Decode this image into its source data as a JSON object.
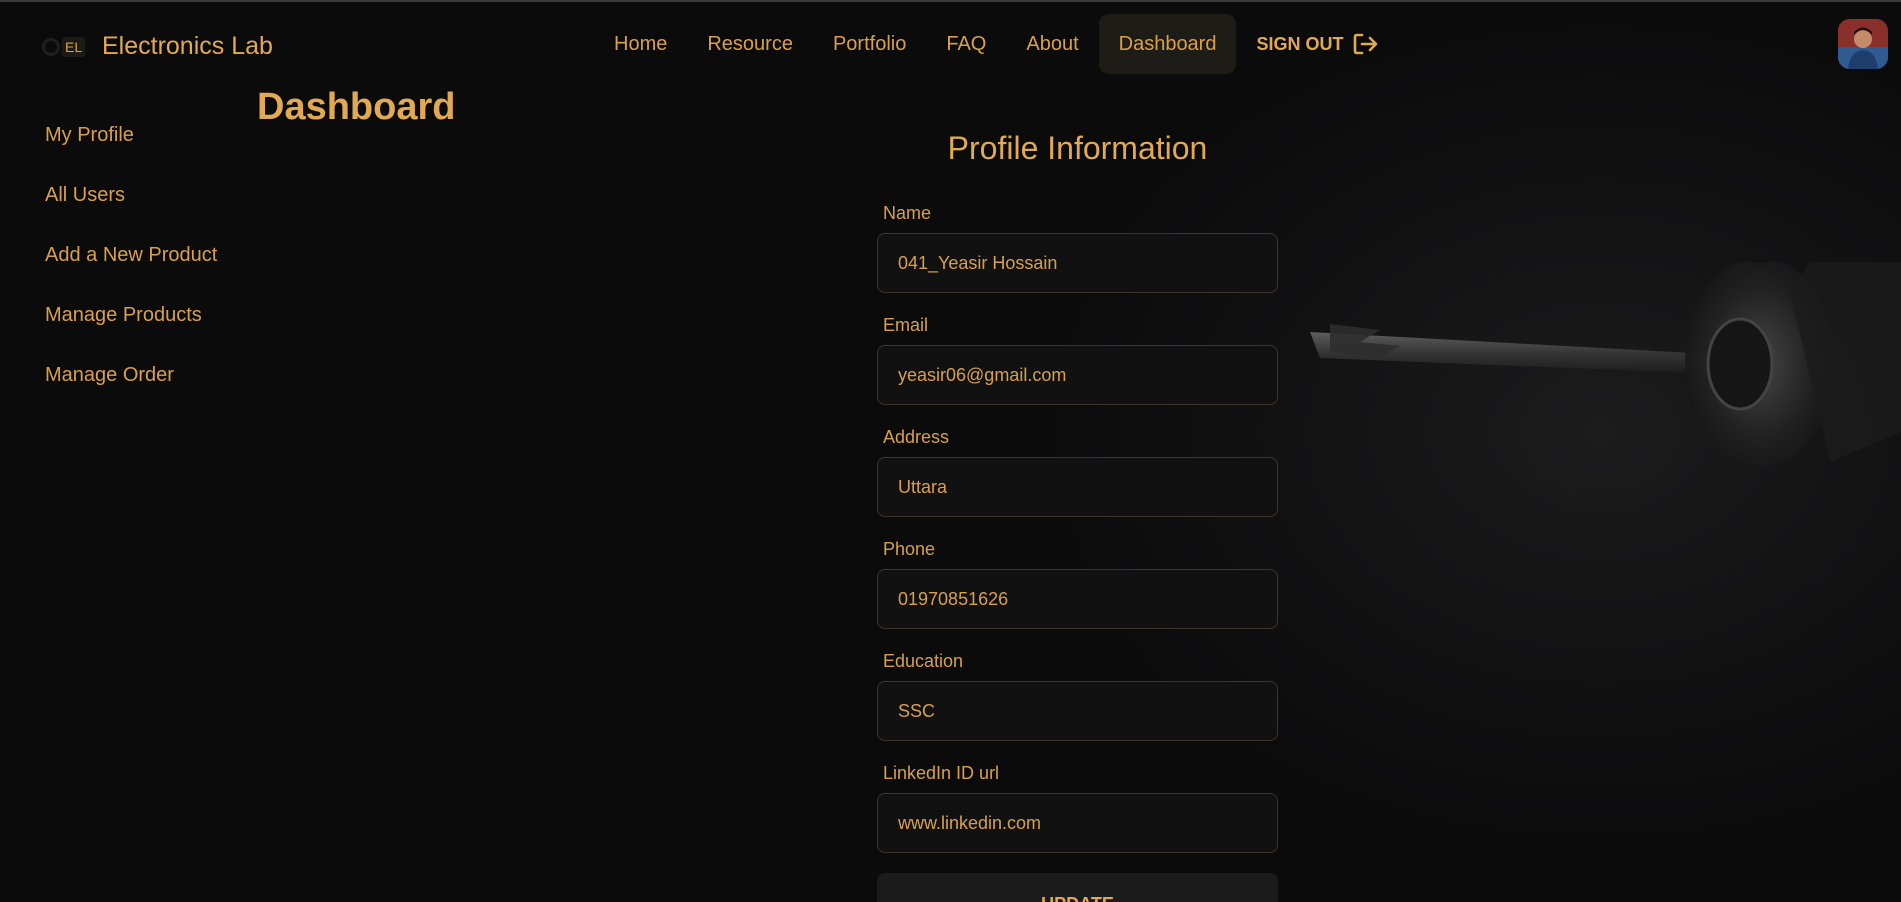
{
  "brand": {
    "logo_text": "EL",
    "name": "Electronics Lab"
  },
  "nav": {
    "items": [
      {
        "label": "Home"
      },
      {
        "label": "Resource"
      },
      {
        "label": "Portfolio"
      },
      {
        "label": "FAQ"
      },
      {
        "label": "About"
      },
      {
        "label": "Dashboard",
        "active": true
      }
    ],
    "signout_label": "SIGN OUT"
  },
  "page": {
    "title": "Dashboard"
  },
  "sidebar": {
    "items": [
      {
        "label": "My Profile"
      },
      {
        "label": "All Users"
      },
      {
        "label": "Add a New Product"
      },
      {
        "label": "Manage Products"
      },
      {
        "label": "Manage Order"
      }
    ]
  },
  "profile_form": {
    "title": "Profile Information",
    "fields": [
      {
        "label": "Name",
        "value": "041_Yeasir Hossain"
      },
      {
        "label": "Email",
        "value": "yeasir06@gmail.com"
      },
      {
        "label": "Address",
        "value": "Uttara"
      },
      {
        "label": "Phone",
        "value": "01970851626"
      },
      {
        "label": "Education",
        "value": "SSC"
      },
      {
        "label": "LinkedIn ID url",
        "value": "www.linkedin.com"
      }
    ],
    "submit_label": "UPDATE"
  },
  "colors": {
    "accent": "#e2a955",
    "background": "#0b0b0c",
    "input_bg": "#111112",
    "input_border": "#3b3628"
  }
}
